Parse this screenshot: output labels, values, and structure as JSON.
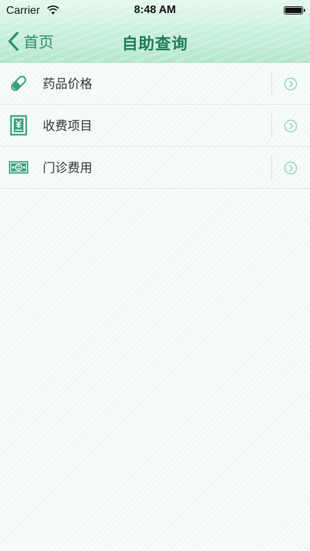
{
  "status_bar": {
    "carrier": "Carrier",
    "time": "8:48 AM"
  },
  "nav": {
    "back_label": "首页",
    "title": "自助查询"
  },
  "menu": {
    "items": [
      {
        "label": "药品价格",
        "icon": "pill-icon"
      },
      {
        "label": "收费项目",
        "icon": "fee-document-icon"
      },
      {
        "label": "门诊费用",
        "icon": "money-bill-icon"
      }
    ]
  },
  "colors": {
    "accent": "#2a8f6a",
    "header": "#c9efdc",
    "icon_fill": "#3aa07e"
  }
}
